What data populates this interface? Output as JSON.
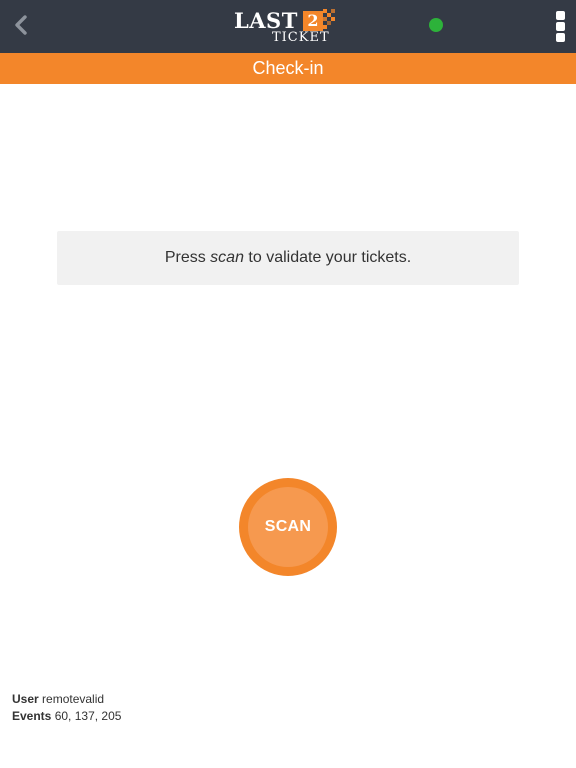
{
  "header": {
    "logo_text_main": "LAST",
    "logo_text_badge": "2",
    "logo_text_sub": "TICKET",
    "back_icon": "chevron-left-icon",
    "menu_icon": "kebab-menu-icon",
    "status_icon": "online-status-icon",
    "status_color": "#2db23a",
    "background_color": "#343a45"
  },
  "titlebar": {
    "title": "Check-in",
    "background_color": "#f3862a"
  },
  "message": {
    "prefix": "Press ",
    "emphasis": "scan",
    "suffix": " to validate your tickets."
  },
  "scan_button": {
    "label": "SCAN",
    "outer_color": "#f3862a",
    "inner_color": "#f6994f"
  },
  "footer": {
    "user_label": "User",
    "user_value": "remotevalid",
    "events_label": "Events",
    "events_value": "60, 137, 205"
  }
}
